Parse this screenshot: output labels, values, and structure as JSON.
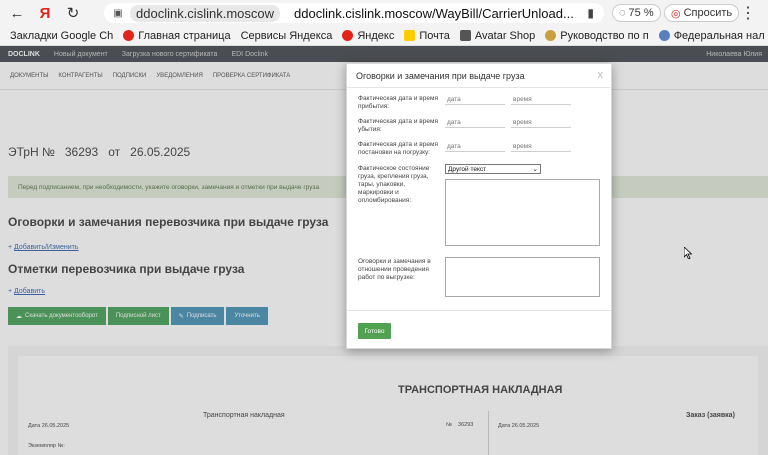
{
  "browser": {
    "back": "←",
    "yandex": "Я",
    "reload": "↻",
    "domain_chip": "ddoclink.cislink.moscow",
    "url_full": "ddoclink.cislink.moscow/WayBill/CarrierUnload...",
    "zoom": "75 %",
    "ask": "Спросить",
    "menu": "⋮"
  },
  "bookmarks": [
    {
      "label": "Закладки Google Ch",
      "icon": "folder-icon"
    },
    {
      "label": "Главная страница",
      "icon": "yandex-icon"
    },
    {
      "label": "Сервисы Яндекса",
      "icon": "none"
    },
    {
      "label": "Яндекс",
      "icon": "yandex-icon"
    },
    {
      "label": "Почта",
      "icon": "mail-icon"
    },
    {
      "label": "Avatar Shop",
      "icon": "shop-icon"
    },
    {
      "label": "Руководство по п",
      "icon": "gear-icon"
    },
    {
      "label": "Федеральная нал",
      "icon": "fed-icon"
    }
  ],
  "app": {
    "brand": "DOCLINK",
    "top_links": [
      "Новый документ",
      "Загрузка нового сертификата",
      "EDI Doclink"
    ],
    "user": "Николаева Юлия",
    "nav": [
      "Документы",
      "Контрагенты",
      "Подписки",
      "Уведомления",
      "Проверка сертификата"
    ],
    "doc_title_prefix": "ЭТрН №",
    "doc_number": "36293",
    "doc_from": "от",
    "doc_date": "26.05.2025",
    "warning": "Перед подписанием, при необходимости, укажите оговорки, замечания и отметки при выдаче груза",
    "section1": "Оговорки и замечания перевозчика при выдаче груза",
    "section1_link": "Добавить/Изменить",
    "section2": "Отметки перевозчика при выдаче груза",
    "section2_link": "Добавить",
    "actions": [
      "Скачать документооборот",
      "Подписной лист",
      "Подписать",
      "Уточнить"
    ],
    "sheet": {
      "title": "ТРАНСПОРТНАЯ НАКЛАДНАЯ",
      "subtitle": "Транспортная накладная",
      "date": "Дата 26.05.2025",
      "num_label": "№",
      "num": "36293",
      "order": "Заказ (заявка)",
      "date2": "Дата 26.05.2025",
      "copy": "Экземпляр №:"
    }
  },
  "modal": {
    "title": "Оговорки и замечания при выдаче груза",
    "close": "x",
    "fields": {
      "arrival_label": "Фактическая дата и время прибытия:",
      "departure_label": "Фактическая дата и время убытия:",
      "loading_label": "Фактическая дата и время постановки на погрузку:",
      "date_placeholder": "дата",
      "time_placeholder": "время",
      "condition_label": "Фактическое состояние груза, крепления груза, тары, упаковки, маркировки и опломбирования:",
      "condition_select": "Другой текст",
      "unloading_label": "Оговорки и замечания в отношении проведения работ по выгрузке:"
    },
    "done": "Готово"
  }
}
